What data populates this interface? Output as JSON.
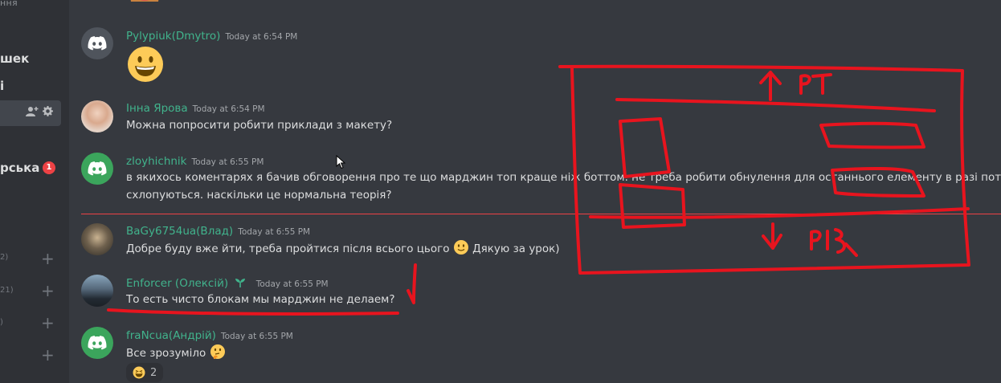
{
  "sidebar": {
    "top_text": "ння",
    "items": [
      {
        "label": "шек"
      },
      {
        "label": "і"
      },
      {
        "label": "рська"
      }
    ],
    "badge_count": "1",
    "counts": [
      "2)",
      "21)",
      ")"
    ]
  },
  "messages": [
    {
      "username": "Pylypiuk(Dmytro)",
      "timestamp": "Today at 6:54 PM",
      "text": "",
      "emoji": "smiley"
    },
    {
      "username": "Інна Ярова",
      "timestamp": "Today at 6:54 PM",
      "text": "Можна попросити робити приклади з макету?"
    },
    {
      "username": "zloyhichnik",
      "timestamp": "Today at 6:55 PM",
      "text_line1": "в якихось коментарях я бачив обговорення про те що марджин топ краще ніж боттом. не треба робити обнулення для останнього елементу в разі потреби",
      "text_line2": "схлопуються. наскільки це нормальна теорія?"
    },
    {
      "username": "BaGy6754ua(Влад)",
      "timestamp": "Today at 6:55 PM",
      "text_before": "Добре буду вже йти, треба пройтися після всього цього",
      "text_after": "Дякую за урок)"
    },
    {
      "username": "Enforcer (Олексій)",
      "timestamp": "Today at 6:55 PM",
      "text": "То есть чисто блокам мы марджин не делаем?"
    },
    {
      "username": "fraNcua(Андрій)",
      "timestamp": "Today at 6:55 PM",
      "text": "Все зрозуміло",
      "reaction_count": "2"
    }
  ],
  "annotations": {
    "top_label": "PT",
    "bottom_label": "PB",
    "ink_color": "#e8141e"
  },
  "colors": {
    "username": "#41b38c",
    "background": "#36393f",
    "sidebar": "#2f3136",
    "new_divider": "#ed4245"
  }
}
